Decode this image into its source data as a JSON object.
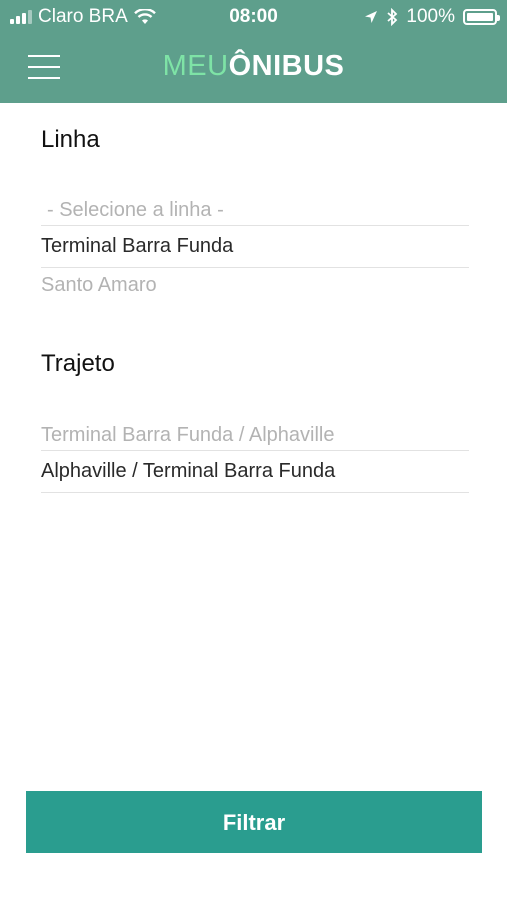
{
  "status_bar": {
    "carrier": "Claro BRA",
    "time": "08:00",
    "battery_text": "100%",
    "battery_level": 1.0,
    "icons": [
      "signal-icon",
      "wifi-icon",
      "location-arrow-icon",
      "bluetooth-icon",
      "battery-icon"
    ]
  },
  "header": {
    "logo_part1": "MEU",
    "logo_part2": "ÔNIBUS",
    "menu_icon": "hamburger-menu-icon",
    "background_color": "#5e9f8c",
    "logo_accent_color": "#7ee3a6"
  },
  "linha": {
    "title": "Linha",
    "options": [
      {
        "label": "- Selecione a linha -",
        "state": "placeholder"
      },
      {
        "label": "Terminal Barra Funda",
        "state": "selected"
      },
      {
        "label": "Santo Amaro",
        "state": "unselected"
      }
    ]
  },
  "trajeto": {
    "title": "Trajeto",
    "options": [
      {
        "label": "Terminal Barra Funda / Alphaville",
        "state": "unselected"
      },
      {
        "label": "Alphaville / Terminal Barra Funda",
        "state": "selected"
      }
    ]
  },
  "filter_button": {
    "label": "Filtrar",
    "color": "#2a9d8f"
  }
}
